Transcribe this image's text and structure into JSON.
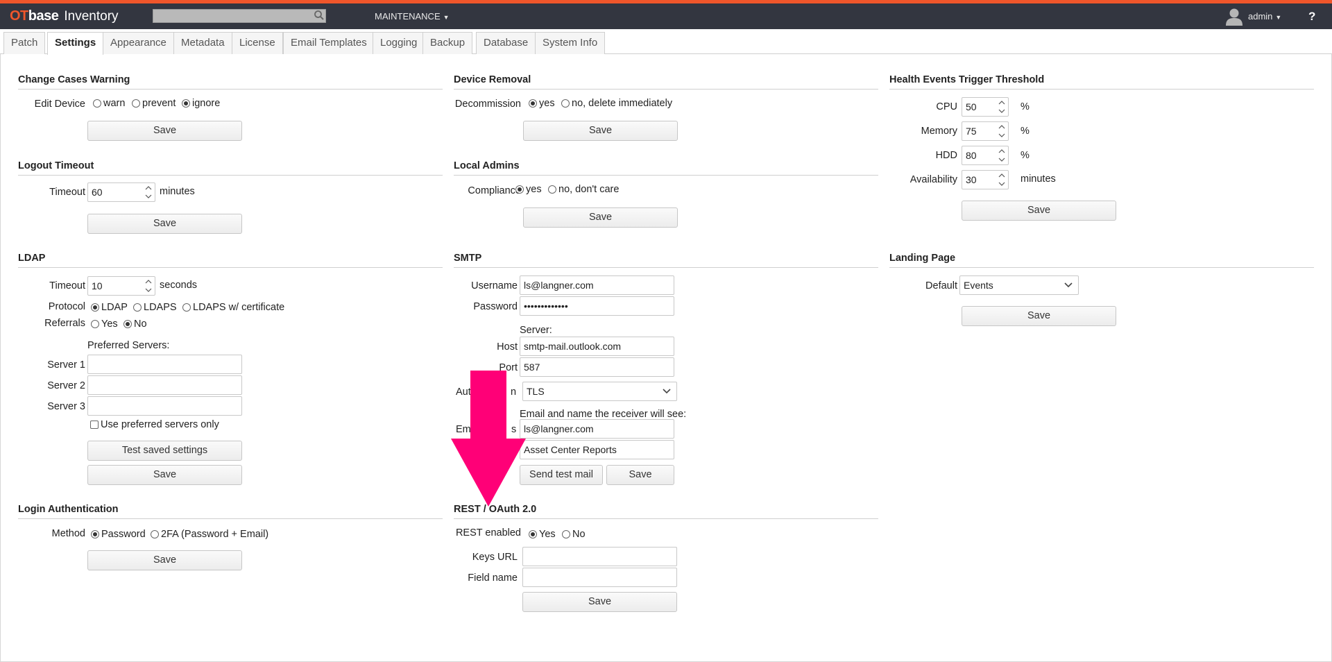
{
  "header": {
    "logo_ot": "OT",
    "logo_base": "base",
    "app_name": "Inventory",
    "search_value": "",
    "menu_label": "MAINTENANCE",
    "user_label": "admin",
    "help_label": "?"
  },
  "tabs": [
    {
      "label": "Patch",
      "active": false
    },
    {
      "label": "Settings",
      "active": true
    },
    {
      "label": "Appearance",
      "active": false
    },
    {
      "label": "Metadata",
      "active": false
    },
    {
      "label": "License",
      "active": false
    },
    {
      "label": "Email Templates",
      "active": false
    },
    {
      "label": "Logging",
      "active": false
    },
    {
      "label": "Backup",
      "active": false
    },
    {
      "label": "Database",
      "active": false
    },
    {
      "label": "System Info",
      "active": false
    }
  ],
  "change_cases": {
    "title": "Change Cases Warning",
    "label": "Edit Device",
    "options": [
      "warn",
      "prevent",
      "ignore"
    ],
    "selected": "ignore",
    "save": "Save"
  },
  "logout": {
    "title": "Logout Timeout",
    "label": "Timeout",
    "value": "60",
    "unit": "minutes",
    "save": "Save"
  },
  "ldap": {
    "title": "LDAP",
    "timeout_label": "Timeout",
    "timeout_value": "10",
    "timeout_unit": "seconds",
    "protocol_label": "Protocol",
    "protocol_options": [
      "LDAP",
      "LDAPS",
      "LDAPS w/ certificate"
    ],
    "protocol_selected": "LDAP",
    "referrals_label": "Referrals",
    "referrals_options": [
      "Yes",
      "No"
    ],
    "referrals_selected": "No",
    "preferred_label": "Preferred Servers:",
    "server1_label": "Server 1",
    "server1_value": "",
    "server2_label": "Server 2",
    "server2_value": "",
    "server3_label": "Server 3",
    "server3_value": "",
    "preferred_only_label": "Use preferred servers only",
    "test_button": "Test saved settings",
    "save": "Save"
  },
  "login_auth": {
    "title": "Login Authentication",
    "label": "Method",
    "options": [
      "Password",
      "2FA (Password + Email)"
    ],
    "selected": "Password",
    "save": "Save"
  },
  "device_removal": {
    "title": "Device Removal",
    "label": "Decommission",
    "options": [
      "yes",
      "no, delete immediately"
    ],
    "selected": "yes",
    "save": "Save"
  },
  "local_admins": {
    "title": "Local Admins",
    "label": "Compliance",
    "options": [
      "yes",
      "no, don't care"
    ],
    "selected": "yes",
    "save": "Save"
  },
  "smtp": {
    "title": "SMTP",
    "username_label": "Username",
    "username_value": "ls@langner.com",
    "password_label": "Password",
    "password_value": "•••••••••••••",
    "server_label": "Server:",
    "host_label": "Host",
    "host_value": "smtp-mail.outlook.com",
    "port_label": "Port",
    "port_value": "587",
    "auth_label_part1": "Aut",
    "auth_label_part2": "n",
    "auth_value": "TLS",
    "receiver_note": "Email and name the receiver will see:",
    "email_label_part1": "Em",
    "email_label_part2": "s",
    "email_value": "ls@langner.com",
    "name_value": "Asset Center Reports",
    "test_button": "Send test mail",
    "save": "Save"
  },
  "rest": {
    "title": "REST / OAuth 2.0",
    "label": "REST enabled",
    "options": [
      "Yes",
      "No"
    ],
    "selected": "Yes",
    "keys_label": "Keys URL",
    "keys_value": "",
    "field_label": "Field name",
    "field_value": "",
    "save": "Save"
  },
  "health": {
    "title": "Health Events Trigger Threshold",
    "cpu_label": "CPU",
    "cpu_value": "50",
    "cpu_unit": "%",
    "memory_label": "Memory",
    "memory_value": "75",
    "memory_unit": "%",
    "hdd_label": "HDD",
    "hdd_value": "80",
    "hdd_unit": "%",
    "availability_label": "Availability",
    "availability_value": "30",
    "availability_unit": "minutes",
    "save": "Save"
  },
  "landing": {
    "title": "Landing Page",
    "label": "Default",
    "value": "Events",
    "save": "Save"
  },
  "colors": {
    "accent": "#f0562b",
    "topbar": "#333640",
    "annotation_arrow": "#ff0077"
  }
}
